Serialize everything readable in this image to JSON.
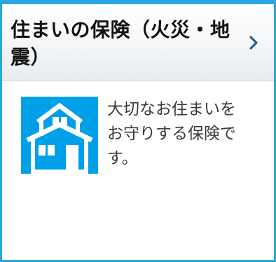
{
  "card": {
    "title": "住まいの保険（火災・地震）",
    "description": "大切なお住まいをお守りする保険です。",
    "icon": "house-icon",
    "link_icon": "chevron-right-icon",
    "colors": {
      "border": "#29a8e0",
      "icon_background": "#00a0e9",
      "chevron": "#2b5f8a",
      "title_text": "#111111",
      "body_text": "#3a3a3a"
    }
  }
}
